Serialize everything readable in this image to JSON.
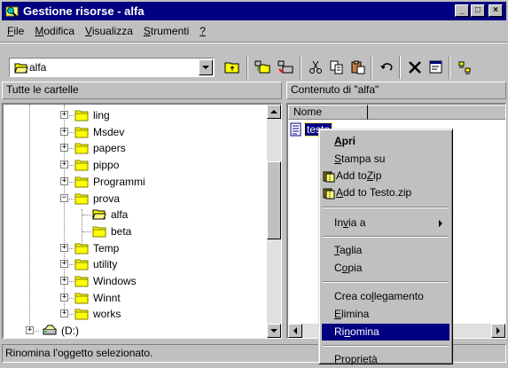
{
  "window": {
    "title": "Gestione risorse - alfa",
    "buttons": {
      "minimize": "_",
      "maximize": "□",
      "close": "×"
    }
  },
  "menu": [
    {
      "label": "File",
      "mnemonic": "F",
      "rest": "ile"
    },
    {
      "label": "Modifica",
      "mnemonic": "M",
      "rest": "odifica"
    },
    {
      "label": "Visualizza",
      "mnemonic": "V",
      "rest": "isualizza"
    },
    {
      "label": "Strumenti",
      "mnemonic": "S",
      "rest": "trumenti"
    },
    {
      "label": "?",
      "mnemonic": "?",
      "rest": ""
    }
  ],
  "toolbar": {
    "address_value": "alfa",
    "icons": [
      "up-folder-icon",
      "map-network-drive-icon",
      "disconnect-drive-icon",
      "cut-icon",
      "copy-icon",
      "paste-icon",
      "undo-icon",
      "delete-icon",
      "properties-icon",
      "large-icons-icon"
    ]
  },
  "tree_pane": {
    "header": "Tutte le cartelle",
    "items": [
      {
        "label": "ling",
        "expander": "+"
      },
      {
        "label": "Msdev",
        "expander": "+"
      },
      {
        "label": "papers",
        "expander": "+"
      },
      {
        "label": "pippo",
        "expander": "+"
      },
      {
        "label": "Programmi",
        "expander": "+"
      },
      {
        "label": "prova",
        "expander": "−"
      },
      {
        "label": "alfa",
        "expander": ""
      },
      {
        "label": "beta",
        "expander": ""
      },
      {
        "label": "Temp",
        "expander": "+"
      },
      {
        "label": "utility",
        "expander": "+"
      },
      {
        "label": "Windows",
        "expander": "+"
      },
      {
        "label": "Winnt",
        "expander": "+"
      },
      {
        "label": "works",
        "expander": "+"
      },
      {
        "label": "(D:)",
        "expander": "+"
      }
    ]
  },
  "content_pane": {
    "header": "Contenuto di \"alfa\"",
    "column_name": "Nome",
    "files": [
      {
        "label": "testo"
      }
    ]
  },
  "context_menu": {
    "open": {
      "pre": "",
      "u": "A",
      "post": "pri"
    },
    "print": {
      "pre": "",
      "u": "S",
      "post": "tampa su"
    },
    "zip": {
      "pre": "Add to ",
      "u": "Z",
      "post": "ip"
    },
    "zip_named": {
      "pre": "",
      "u": "A",
      "post": "dd to Testo.zip"
    },
    "send_to": {
      "pre": "In",
      "u": "v",
      "post": "ia a"
    },
    "cut": {
      "pre": "",
      "u": "T",
      "post": "aglia"
    },
    "copy": {
      "pre": "C",
      "u": "o",
      "post": "pia"
    },
    "shortcut": {
      "pre": "Crea co",
      "u": "l",
      "post": "legamento"
    },
    "delete": {
      "pre": "",
      "u": "E",
      "post": "limina"
    },
    "rename": {
      "pre": "Ri",
      "u": "n",
      "post": "omina"
    },
    "properties": {
      "pre": "P",
      "u": "r",
      "post": "oprietà"
    }
  },
  "status": "Rinomina l'oggetto selezionato.",
  "colors": {
    "title_bg": "#000080",
    "face": "#c0c0c0",
    "highlight": "#000080",
    "folder": "#ffff00"
  }
}
